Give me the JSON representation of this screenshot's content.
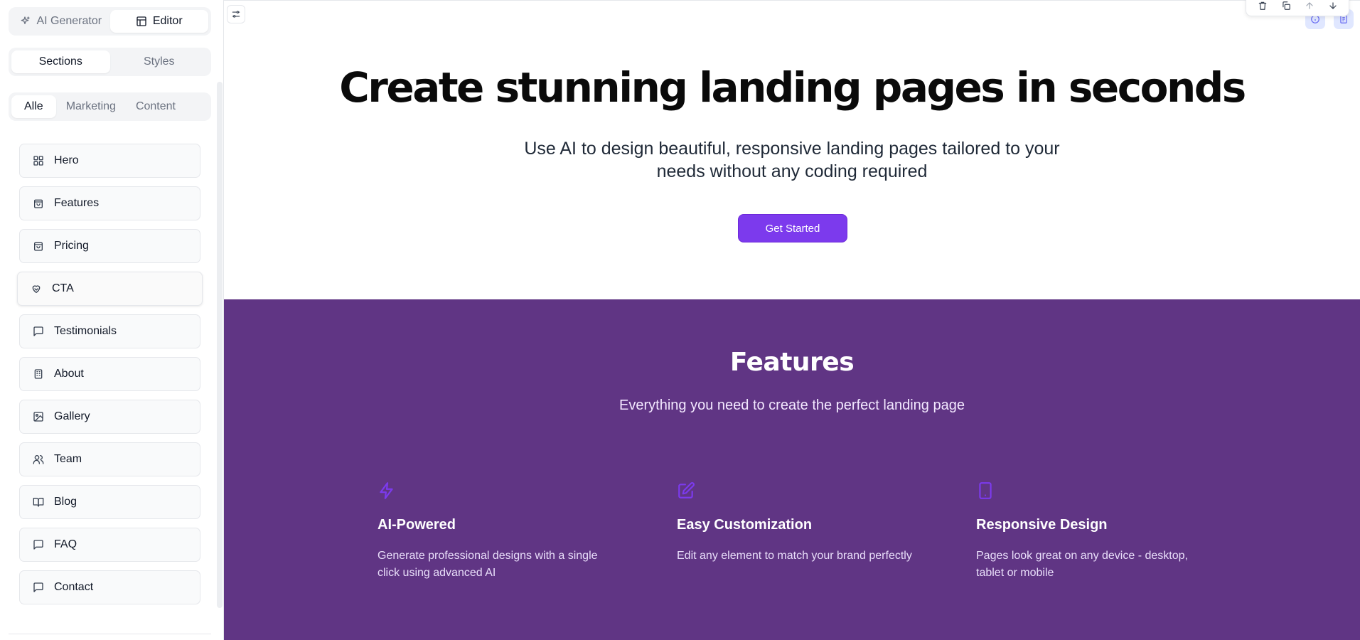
{
  "sidebar": {
    "mode": {
      "ai_generator": "AI Generator",
      "editor": "Editor",
      "active": "Editor"
    },
    "tabs": {
      "sections": "Sections",
      "styles": "Styles",
      "active": "Sections"
    },
    "filters": {
      "all": "Alle",
      "marketing": "Marketing",
      "content": "Content",
      "active": "Alle"
    },
    "sections": [
      {
        "label": "Hero",
        "icon": "layout-grid-icon"
      },
      {
        "label": "Features",
        "icon": "shopping-bag-icon"
      },
      {
        "label": "Pricing",
        "icon": "shopping-bag-icon"
      },
      {
        "label": "CTA",
        "icon": "hand-heart-icon"
      },
      {
        "label": "Testimonials",
        "icon": "message-square-icon"
      },
      {
        "label": "About",
        "icon": "building-icon"
      },
      {
        "label": "Gallery",
        "icon": "image-icon"
      },
      {
        "label": "Team",
        "icon": "users-icon"
      },
      {
        "label": "Blog",
        "icon": "book-open-icon"
      },
      {
        "label": "FAQ",
        "icon": "message-square-icon"
      },
      {
        "label": "Contact",
        "icon": "message-square-icon"
      }
    ]
  },
  "canvas": {
    "hero": {
      "title": "Create stunning landing pages in seconds",
      "subtitle": "Use AI to design beautiful, responsive landing pages tailored to your needs without any coding required",
      "cta": "Get Started"
    },
    "features": {
      "title": "Features",
      "subtitle": "Everything you need to create the perfect landing page",
      "items": [
        {
          "title": "AI-Powered",
          "description": "Generate professional designs with a single click using advanced AI",
          "icon": "zap-icon"
        },
        {
          "title": "Easy Customization",
          "description": "Edit any element to match your brand perfectly",
          "icon": "edit-icon"
        },
        {
          "title": "Responsive Design",
          "description": "Pages look great on any device - desktop, tablet or mobile",
          "icon": "tablet-icon"
        }
      ]
    }
  },
  "colors": {
    "accent": "#7c3aed",
    "features_bg": "#603584"
  }
}
